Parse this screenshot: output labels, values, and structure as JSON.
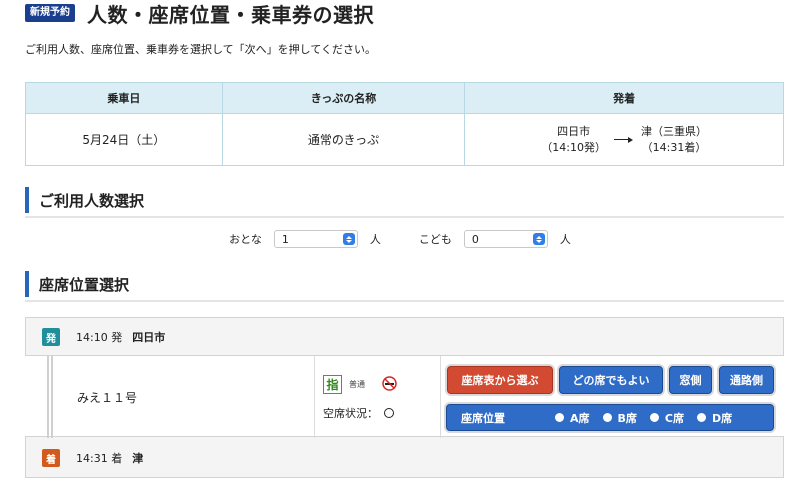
{
  "header": {
    "badge": "新規予約",
    "title": "人数・座席位置・乗車券の選択"
  },
  "instruction": "ご利用人数、座席位置、乗車券を選択して「次へ」を押してください。",
  "info_table": {
    "headers": [
      "乗車日",
      "きっぷの名称",
      "発着"
    ],
    "date": "5月24日（土）",
    "ticket_name": "通常のきっぷ",
    "from": {
      "station": "四日市",
      "time": "（14:10発）"
    },
    "to": {
      "station": "津（三重県）",
      "time": "（14:31着）"
    }
  },
  "passenger_section": {
    "title": "ご利用人数選択",
    "adult_label": "おとな",
    "adult_value": "1",
    "adult_unit": "人",
    "child_label": "こども",
    "child_value": "0",
    "child_unit": "人"
  },
  "seat_section": {
    "title": "座席位置選択",
    "departure": {
      "badge": "発",
      "time": "14:10 発",
      "station": "四日市"
    },
    "arrival": {
      "badge": "着",
      "time": "14:31 着",
      "station": "津"
    },
    "train_name": "みえ１１号",
    "reserved_icon": "指",
    "car_type": "普通",
    "vacancy_label": "空席状況：",
    "buttons": {
      "choose_map": "座席表から選ぶ",
      "any_seat": "どの席でもよい",
      "window": "窓側",
      "aisle": "通路側"
    },
    "seat_position": {
      "label": "座席位置",
      "options": [
        "A席",
        "B席",
        "C席",
        "D席"
      ]
    }
  },
  "colors": {
    "accent_blue": "#2f6cc7",
    "red_button": "#d24a32",
    "table_header": "#dbeef5",
    "departure_badge": "#1f8f9b",
    "arrival_badge": "#d35a1d"
  }
}
